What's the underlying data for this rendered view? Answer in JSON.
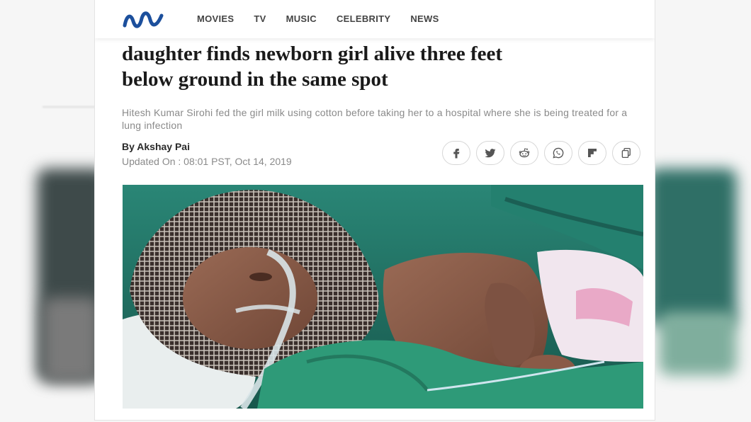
{
  "nav": {
    "items": [
      "MOVIES",
      "TV",
      "MUSIC",
      "CELEBRITY",
      "NEWS"
    ]
  },
  "article": {
    "headline_line1": "daughter finds newborn girl alive three feet",
    "headline_line2": "below ground in the same spot",
    "subhead": "Hitesh Kumar Sirohi fed the girl milk using cotton before taking her to a hospital where she is being treated for a lung infection",
    "byline": "By Akshay Pai",
    "updated": "Updated On : 08:01 PST, Oct 14, 2019"
  },
  "share": {
    "icons": [
      "facebook-icon",
      "twitter-icon",
      "reddit-icon",
      "whatsapp-icon",
      "flipboard-icon",
      "copy-link-icon"
    ]
  },
  "colors": {
    "logo": "#1c4f9c",
    "nav_text": "#444444",
    "headline": "#1a1a1a",
    "muted": "#8a8a8a",
    "hero_green": "#1f6e62"
  }
}
